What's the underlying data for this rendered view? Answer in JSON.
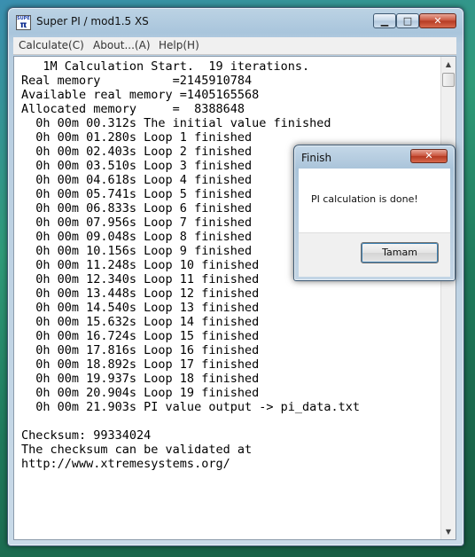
{
  "window": {
    "title": "Super PI / mod1.5 XS",
    "icon_text_top": "SUPER",
    "icon_text_bottom": "π",
    "minimize_glyph": "▁",
    "maximize_glyph": "□",
    "close_glyph": "✕"
  },
  "menu": {
    "items": [
      {
        "label": "Calculate(C)"
      },
      {
        "label": "About...(A)"
      },
      {
        "label": "Help(H)"
      }
    ]
  },
  "console": {
    "lines": [
      "   1M Calculation Start.  19 iterations.",
      "Real memory          =2145910784",
      "Available real memory =1405165568",
      "Allocated memory     =  8388648",
      "  0h 00m 00.312s The initial value finished",
      "  0h 00m 01.280s Loop 1 finished",
      "  0h 00m 02.403s Loop 2 finished",
      "  0h 00m 03.510s Loop 3 finished",
      "  0h 00m 04.618s Loop 4 finished",
      "  0h 00m 05.741s Loop 5 finished",
      "  0h 00m 06.833s Loop 6 finished",
      "  0h 00m 07.956s Loop 7 finished",
      "  0h 00m 09.048s Loop 8 finished",
      "  0h 00m 10.156s Loop 9 finished",
      "  0h 00m 11.248s Loop 10 finished",
      "  0h 00m 12.340s Loop 11 finished",
      "  0h 00m 13.448s Loop 12 finished",
      "  0h 00m 14.540s Loop 13 finished",
      "  0h 00m 15.632s Loop 14 finished",
      "  0h 00m 16.724s Loop 15 finished",
      "  0h 00m 17.816s Loop 16 finished",
      "  0h 00m 18.892s Loop 17 finished",
      "  0h 00m 19.937s Loop 18 finished",
      "  0h 00m 20.904s Loop 19 finished",
      "  0h 00m 21.903s PI value output -> pi_data.txt",
      "",
      "Checksum: 99334024",
      "The checksum can be validated at",
      "http://www.xtremesystems.org/"
    ]
  },
  "scrollbar": {
    "up_glyph": "▲",
    "down_glyph": "▼"
  },
  "dialog": {
    "title": "Finish",
    "close_glyph": "✕",
    "message": "PI calculation is done!",
    "ok_label": "Tamam"
  }
}
